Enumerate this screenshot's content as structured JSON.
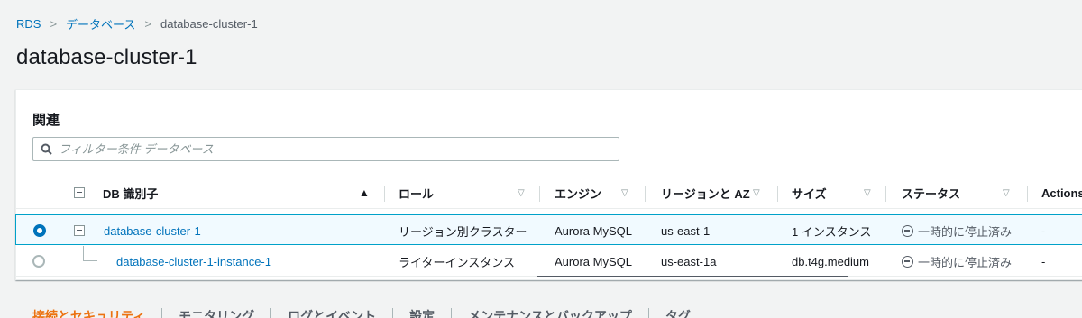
{
  "breadcrumb": {
    "root": "RDS",
    "parent": "データベース",
    "current": "database-cluster-1"
  },
  "page_title": "database-cluster-1",
  "panel": {
    "title": "関連",
    "search_placeholder": "フィルター条件 データベース"
  },
  "table": {
    "headers": {
      "id": "DB 識別子",
      "role": "ロール",
      "engine": "エンジン",
      "region": "リージョンと AZ",
      "size": "サイズ",
      "status": "ステータス",
      "actions": "Actions"
    },
    "sort_asc": "▲",
    "sort_none": "▽",
    "rows": [
      {
        "id": "database-cluster-1",
        "role": "リージョン別クラスター",
        "engine": "Aurora MySQL",
        "region": "us-east-1",
        "size": "1 インスタンス",
        "status": "一時的に停止済み",
        "actions": "-"
      },
      {
        "id": "database-cluster-1-instance-1",
        "role": "ライターインスタンス",
        "engine": "Aurora MySQL",
        "region": "us-east-1a",
        "size": "db.t4g.medium",
        "status": "一時的に停止済み",
        "actions": "-"
      }
    ]
  },
  "tabs": [
    "接続とセキュリティ",
    "モニタリング",
    "ログとイベント",
    "設定",
    "メンテナンスとバックアップ",
    "タグ"
  ],
  "colors": {
    "link": "#0073bb",
    "accent": "#ec7211",
    "selected_border": "#00a1c9"
  }
}
